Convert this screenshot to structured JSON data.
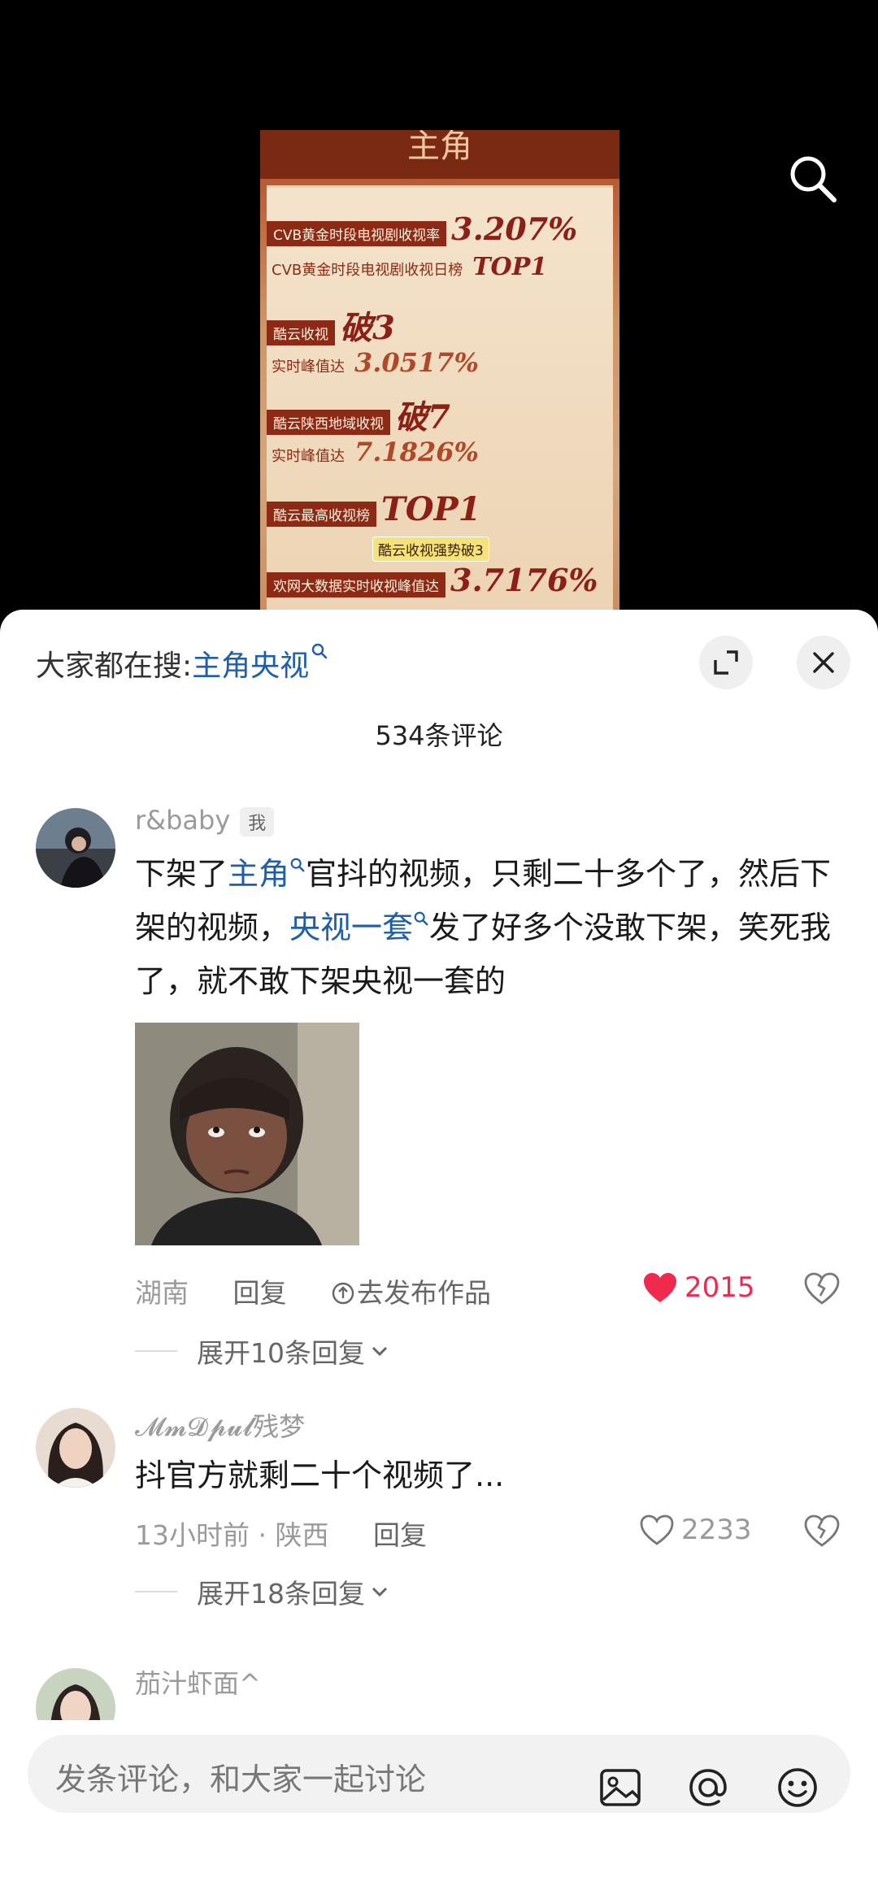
{
  "video": {
    "poster_title": "主角",
    "stats": [
      {
        "label": "CVB黄金时段电视剧收视率",
        "value": "3.207%"
      },
      {
        "label": "CVB黄金时段电视剧收视日榜",
        "value": "TOP1"
      },
      {
        "label": "酷云收视",
        "value": "破3"
      },
      {
        "label": "实时峰值达",
        "value": "3.0517%"
      },
      {
        "label": "酷云陕西地域收视",
        "value": "破7"
      },
      {
        "label": "实时峰值达",
        "value": "7.1826%"
      },
      {
        "label": "酷云最高收视榜",
        "value": "TOP1"
      },
      {
        "label": "欢网大数据实时收视峰值达",
        "value": "3.7176%"
      }
    ],
    "caption": "酷云收视强势破3",
    "search_icon": "search-icon"
  },
  "sheet": {
    "hot_search_prefix": "大家都在搜:",
    "hot_search_term": "主角央视",
    "comment_count": "534条评论",
    "expand_icon": "expand-icon",
    "close_icon": "close-icon"
  },
  "comments": [
    {
      "username": "r&baby",
      "badge": "我",
      "text_parts": [
        "下架了",
        "主角",
        "官抖的视频，只剩二十多个了，然后下架的视频，",
        "央视一套",
        "发了好多个没敢下架，笑死我了，就不敢下架央视一套的"
      ],
      "location": "湖南",
      "reply_label": "回复",
      "publish_label": "去发布作品",
      "likes": "2015",
      "liked": true,
      "expand_label": "展开10条回复"
    },
    {
      "username": "𝓜𝓶𝓓𝓹𝓾𝓵残梦",
      "text": "抖官方就剩二十个视频了...",
      "time_location": "13小时前 · 陕西",
      "reply_label": "回复",
      "likes": "2233",
      "liked": false,
      "expand_label": "展开18条回复"
    },
    {
      "username": "茄汁虾面^"
    }
  ],
  "input_bar": {
    "placeholder": "发条评论，和大家一起讨论",
    "icons": [
      "image-icon",
      "at-icon",
      "emoji-icon"
    ]
  },
  "colors": {
    "link": "#1f5fa8",
    "like_active": "#f0294f",
    "sheet_bg": "#ffffff"
  }
}
